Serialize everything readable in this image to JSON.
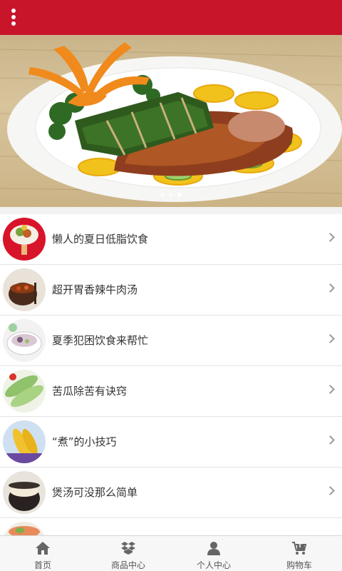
{
  "header": {
    "menu_icon": "more-vertical-icon",
    "background": "#c8152a"
  },
  "banner": {
    "slides": 3,
    "active_slide": 3
  },
  "list": {
    "items": [
      {
        "label": "懒人的夏日低脂饮食"
      },
      {
        "label": "超开胃香辣牛肉汤"
      },
      {
        "label": "夏季犯困饮食来帮忙"
      },
      {
        "label": "苦瓜除苦有诀窍"
      },
      {
        "label": "“煮”的小技巧"
      },
      {
        "label": "煲汤可没那么简单"
      },
      {
        "label": ""
      }
    ],
    "chevron_icon": "chevron-right-icon"
  },
  "tabbar": {
    "tabs": [
      {
        "label": "首页",
        "icon": "home-icon"
      },
      {
        "label": "商品中心",
        "icon": "box-icon"
      },
      {
        "label": "个人中心",
        "icon": "user-icon"
      },
      {
        "label": "购物车",
        "icon": "cart-icon"
      }
    ]
  }
}
